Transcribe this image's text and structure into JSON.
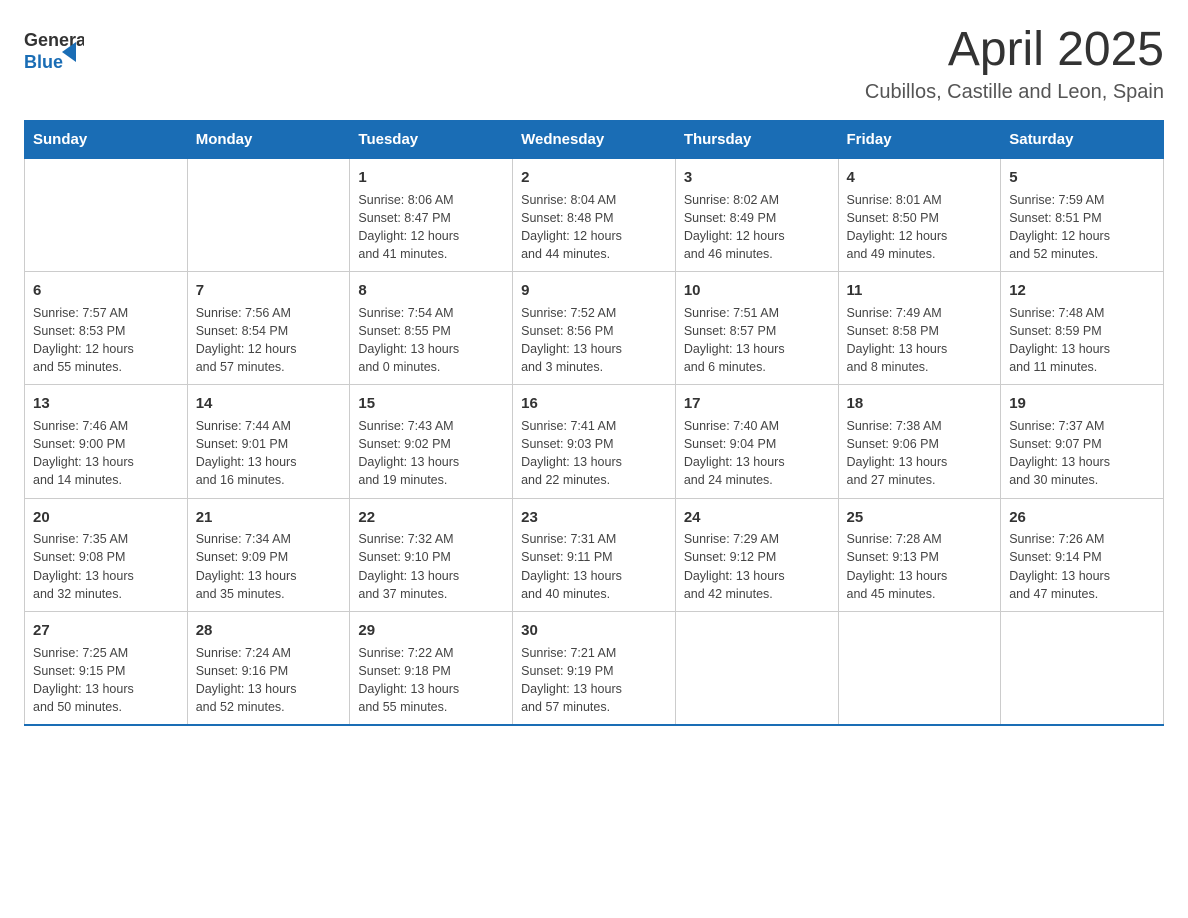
{
  "logo": {
    "text_general": "General",
    "text_blue": "Blue"
  },
  "title": "April 2025",
  "subtitle": "Cubillos, Castille and Leon, Spain",
  "header": {
    "days": [
      "Sunday",
      "Monday",
      "Tuesday",
      "Wednesday",
      "Thursday",
      "Friday",
      "Saturday"
    ]
  },
  "weeks": [
    {
      "cells": [
        {
          "day": "",
          "info": ""
        },
        {
          "day": "",
          "info": ""
        },
        {
          "day": "1",
          "info": "Sunrise: 8:06 AM\nSunset: 8:47 PM\nDaylight: 12 hours\nand 41 minutes."
        },
        {
          "day": "2",
          "info": "Sunrise: 8:04 AM\nSunset: 8:48 PM\nDaylight: 12 hours\nand 44 minutes."
        },
        {
          "day": "3",
          "info": "Sunrise: 8:02 AM\nSunset: 8:49 PM\nDaylight: 12 hours\nand 46 minutes."
        },
        {
          "day": "4",
          "info": "Sunrise: 8:01 AM\nSunset: 8:50 PM\nDaylight: 12 hours\nand 49 minutes."
        },
        {
          "day": "5",
          "info": "Sunrise: 7:59 AM\nSunset: 8:51 PM\nDaylight: 12 hours\nand 52 minutes."
        }
      ]
    },
    {
      "cells": [
        {
          "day": "6",
          "info": "Sunrise: 7:57 AM\nSunset: 8:53 PM\nDaylight: 12 hours\nand 55 minutes."
        },
        {
          "day": "7",
          "info": "Sunrise: 7:56 AM\nSunset: 8:54 PM\nDaylight: 12 hours\nand 57 minutes."
        },
        {
          "day": "8",
          "info": "Sunrise: 7:54 AM\nSunset: 8:55 PM\nDaylight: 13 hours\nand 0 minutes."
        },
        {
          "day": "9",
          "info": "Sunrise: 7:52 AM\nSunset: 8:56 PM\nDaylight: 13 hours\nand 3 minutes."
        },
        {
          "day": "10",
          "info": "Sunrise: 7:51 AM\nSunset: 8:57 PM\nDaylight: 13 hours\nand 6 minutes."
        },
        {
          "day": "11",
          "info": "Sunrise: 7:49 AM\nSunset: 8:58 PM\nDaylight: 13 hours\nand 8 minutes."
        },
        {
          "day": "12",
          "info": "Sunrise: 7:48 AM\nSunset: 8:59 PM\nDaylight: 13 hours\nand 11 minutes."
        }
      ]
    },
    {
      "cells": [
        {
          "day": "13",
          "info": "Sunrise: 7:46 AM\nSunset: 9:00 PM\nDaylight: 13 hours\nand 14 minutes."
        },
        {
          "day": "14",
          "info": "Sunrise: 7:44 AM\nSunset: 9:01 PM\nDaylight: 13 hours\nand 16 minutes."
        },
        {
          "day": "15",
          "info": "Sunrise: 7:43 AM\nSunset: 9:02 PM\nDaylight: 13 hours\nand 19 minutes."
        },
        {
          "day": "16",
          "info": "Sunrise: 7:41 AM\nSunset: 9:03 PM\nDaylight: 13 hours\nand 22 minutes."
        },
        {
          "day": "17",
          "info": "Sunrise: 7:40 AM\nSunset: 9:04 PM\nDaylight: 13 hours\nand 24 minutes."
        },
        {
          "day": "18",
          "info": "Sunrise: 7:38 AM\nSunset: 9:06 PM\nDaylight: 13 hours\nand 27 minutes."
        },
        {
          "day": "19",
          "info": "Sunrise: 7:37 AM\nSunset: 9:07 PM\nDaylight: 13 hours\nand 30 minutes."
        }
      ]
    },
    {
      "cells": [
        {
          "day": "20",
          "info": "Sunrise: 7:35 AM\nSunset: 9:08 PM\nDaylight: 13 hours\nand 32 minutes."
        },
        {
          "day": "21",
          "info": "Sunrise: 7:34 AM\nSunset: 9:09 PM\nDaylight: 13 hours\nand 35 minutes."
        },
        {
          "day": "22",
          "info": "Sunrise: 7:32 AM\nSunset: 9:10 PM\nDaylight: 13 hours\nand 37 minutes."
        },
        {
          "day": "23",
          "info": "Sunrise: 7:31 AM\nSunset: 9:11 PM\nDaylight: 13 hours\nand 40 minutes."
        },
        {
          "day": "24",
          "info": "Sunrise: 7:29 AM\nSunset: 9:12 PM\nDaylight: 13 hours\nand 42 minutes."
        },
        {
          "day": "25",
          "info": "Sunrise: 7:28 AM\nSunset: 9:13 PM\nDaylight: 13 hours\nand 45 minutes."
        },
        {
          "day": "26",
          "info": "Sunrise: 7:26 AM\nSunset: 9:14 PM\nDaylight: 13 hours\nand 47 minutes."
        }
      ]
    },
    {
      "cells": [
        {
          "day": "27",
          "info": "Sunrise: 7:25 AM\nSunset: 9:15 PM\nDaylight: 13 hours\nand 50 minutes."
        },
        {
          "day": "28",
          "info": "Sunrise: 7:24 AM\nSunset: 9:16 PM\nDaylight: 13 hours\nand 52 minutes."
        },
        {
          "day": "29",
          "info": "Sunrise: 7:22 AM\nSunset: 9:18 PM\nDaylight: 13 hours\nand 55 minutes."
        },
        {
          "day": "30",
          "info": "Sunrise: 7:21 AM\nSunset: 9:19 PM\nDaylight: 13 hours\nand 57 minutes."
        },
        {
          "day": "",
          "info": ""
        },
        {
          "day": "",
          "info": ""
        },
        {
          "day": "",
          "info": ""
        }
      ]
    }
  ]
}
